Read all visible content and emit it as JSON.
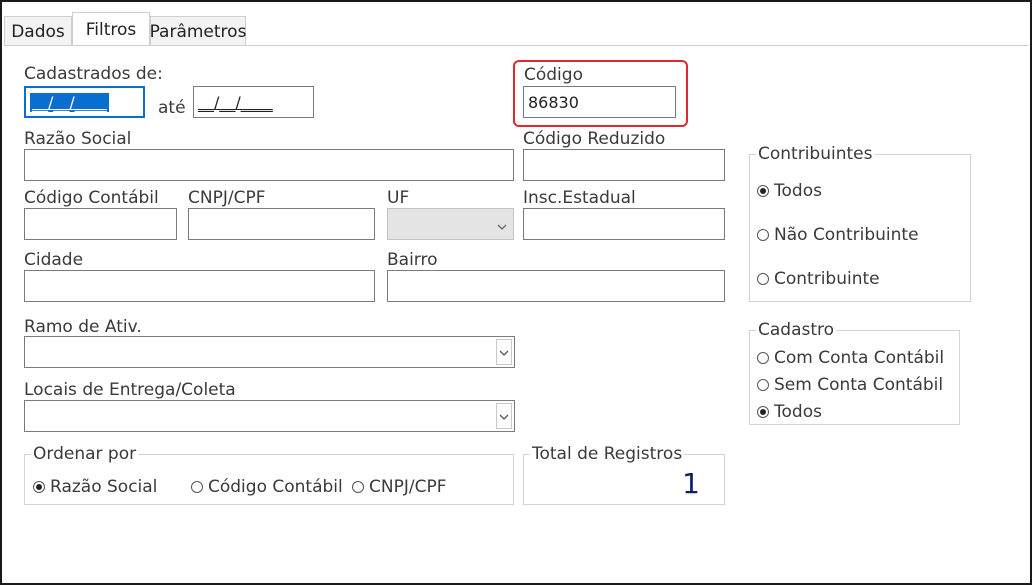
{
  "tabs": [
    {
      "label": "Dados",
      "active": false
    },
    {
      "label": "Filtros",
      "active": true
    },
    {
      "label": "Parâmetros",
      "active": false
    }
  ],
  "filters": {
    "cadastrados_label": "Cadastrados de:",
    "date_from": "__/__/____",
    "ate_label": "até",
    "date_to": "__/__/____",
    "codigo_label": "Código",
    "codigo_value": "86830",
    "razao_social_label": "Razão Social",
    "razao_social_value": "",
    "codigo_reduzido_label": "Código Reduzido",
    "codigo_reduzido_value": "",
    "codigo_contabil_label": "Código Contábil",
    "codigo_contabil_value": "",
    "cnpj_label": "CNPJ/CPF",
    "cnpj_value": "",
    "uf_label": "UF",
    "uf_value": "",
    "insc_label": "Insc.Estadual",
    "insc_value": "",
    "cidade_label": "Cidade",
    "cidade_value": "",
    "bairro_label": "Bairro",
    "bairro_value": "",
    "ramo_label": "Ramo de Ativ.",
    "ramo_value": "",
    "locais_label": "Locais de Entrega/Coleta",
    "locais_value": ""
  },
  "ordenar": {
    "title": "Ordenar por",
    "options": [
      {
        "label": "Razão Social",
        "selected": true
      },
      {
        "label": "Código Contábil",
        "selected": false
      },
      {
        "label": "CNPJ/CPF",
        "selected": false
      }
    ]
  },
  "total": {
    "title": "Total de Registros",
    "value": "1"
  },
  "contribuintes": {
    "title": "Contribuintes",
    "options": [
      {
        "label": "Todos",
        "selected": true
      },
      {
        "label": "Não Contribuinte",
        "selected": false
      },
      {
        "label": "Contribuinte",
        "selected": false
      }
    ]
  },
  "cadastro": {
    "title": "Cadastro",
    "options": [
      {
        "label": "Com Conta Contábil",
        "selected": false
      },
      {
        "label": "Sem Conta Contábil",
        "selected": false
      },
      {
        "label": "Todos",
        "selected": true
      }
    ]
  },
  "colors": {
    "highlight": "#e0282e",
    "selection": "#0a6ed1",
    "total_value": "#0b1f6b"
  }
}
